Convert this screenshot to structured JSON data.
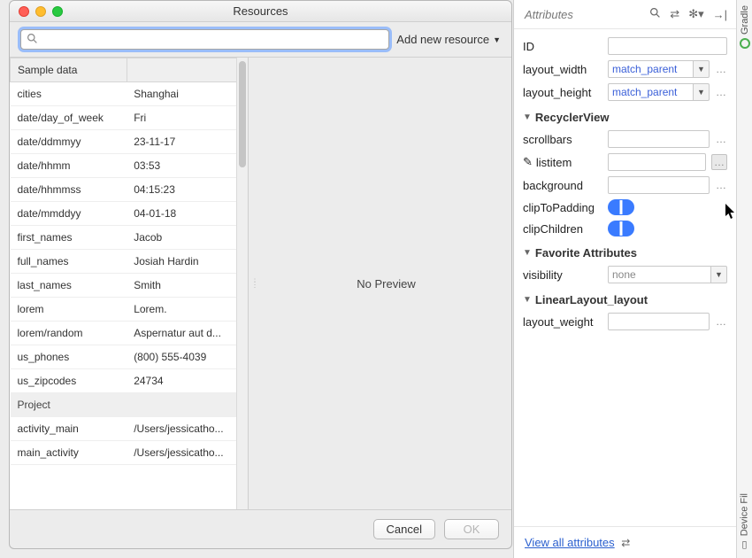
{
  "dialog": {
    "title": "Resources",
    "search_placeholder": "",
    "add_new_label": "Add new resource",
    "columns": {
      "c0": "Sample data",
      "c1": ""
    },
    "groups": [
      {
        "name": "Sample data",
        "rows": [
          {
            "k": "cities",
            "v": "Shanghai"
          },
          {
            "k": "date/day_of_week",
            "v": "Fri"
          },
          {
            "k": "date/ddmmyy",
            "v": "23-11-17"
          },
          {
            "k": "date/hhmm",
            "v": "03:53"
          },
          {
            "k": "date/hhmmss",
            "v": "04:15:23"
          },
          {
            "k": "date/mmddyy",
            "v": "04-01-18"
          },
          {
            "k": "first_names",
            "v": "Jacob"
          },
          {
            "k": "full_names",
            "v": "Josiah Hardin"
          },
          {
            "k": "last_names",
            "v": "Smith"
          },
          {
            "k": "lorem",
            "v": "Lorem."
          },
          {
            "k": "lorem/random",
            "v": "Aspernatur aut d..."
          },
          {
            "k": "us_phones",
            "v": "(800) 555-4039"
          },
          {
            "k": "us_zipcodes",
            "v": "24734"
          }
        ]
      },
      {
        "name": "Project",
        "rows": [
          {
            "k": "activity_main",
            "v": "/Users/jessicatho..."
          },
          {
            "k": "main_activity",
            "v": "/Users/jessicatho..."
          }
        ]
      }
    ],
    "preview_text": "No Preview",
    "buttons": {
      "cancel": "Cancel",
      "ok": "OK"
    }
  },
  "attrs": {
    "title": "Attributes",
    "top": {
      "id": {
        "label": "ID",
        "value": ""
      },
      "layout_width": {
        "label": "layout_width",
        "value": "match_parent"
      },
      "layout_height": {
        "label": "layout_height",
        "value": "match_parent"
      }
    },
    "sections": [
      {
        "name": "RecyclerView",
        "rows": [
          {
            "key": "scrollbars",
            "type": "text",
            "value": ""
          },
          {
            "key": "listitem",
            "type": "text",
            "value": "",
            "icon": "pencil",
            "more_solid": true
          },
          {
            "key": "background",
            "type": "text",
            "value": ""
          },
          {
            "key": "clipToPadding",
            "type": "toggle",
            "value": true
          },
          {
            "key": "clipChildren",
            "type": "toggle",
            "value": true
          }
        ]
      },
      {
        "name": "Favorite Attributes",
        "rows": [
          {
            "key": "visibility",
            "type": "combo",
            "value": "none"
          }
        ]
      },
      {
        "name": "LinearLayout_layout",
        "rows": [
          {
            "key": "layout_weight",
            "type": "text",
            "value": ""
          }
        ]
      }
    ],
    "footer_link": "View all attributes"
  },
  "rail": {
    "items": [
      {
        "label": "Gradle",
        "icon": "gradle"
      },
      {
        "label": "Device Fil",
        "icon": "device"
      }
    ]
  }
}
